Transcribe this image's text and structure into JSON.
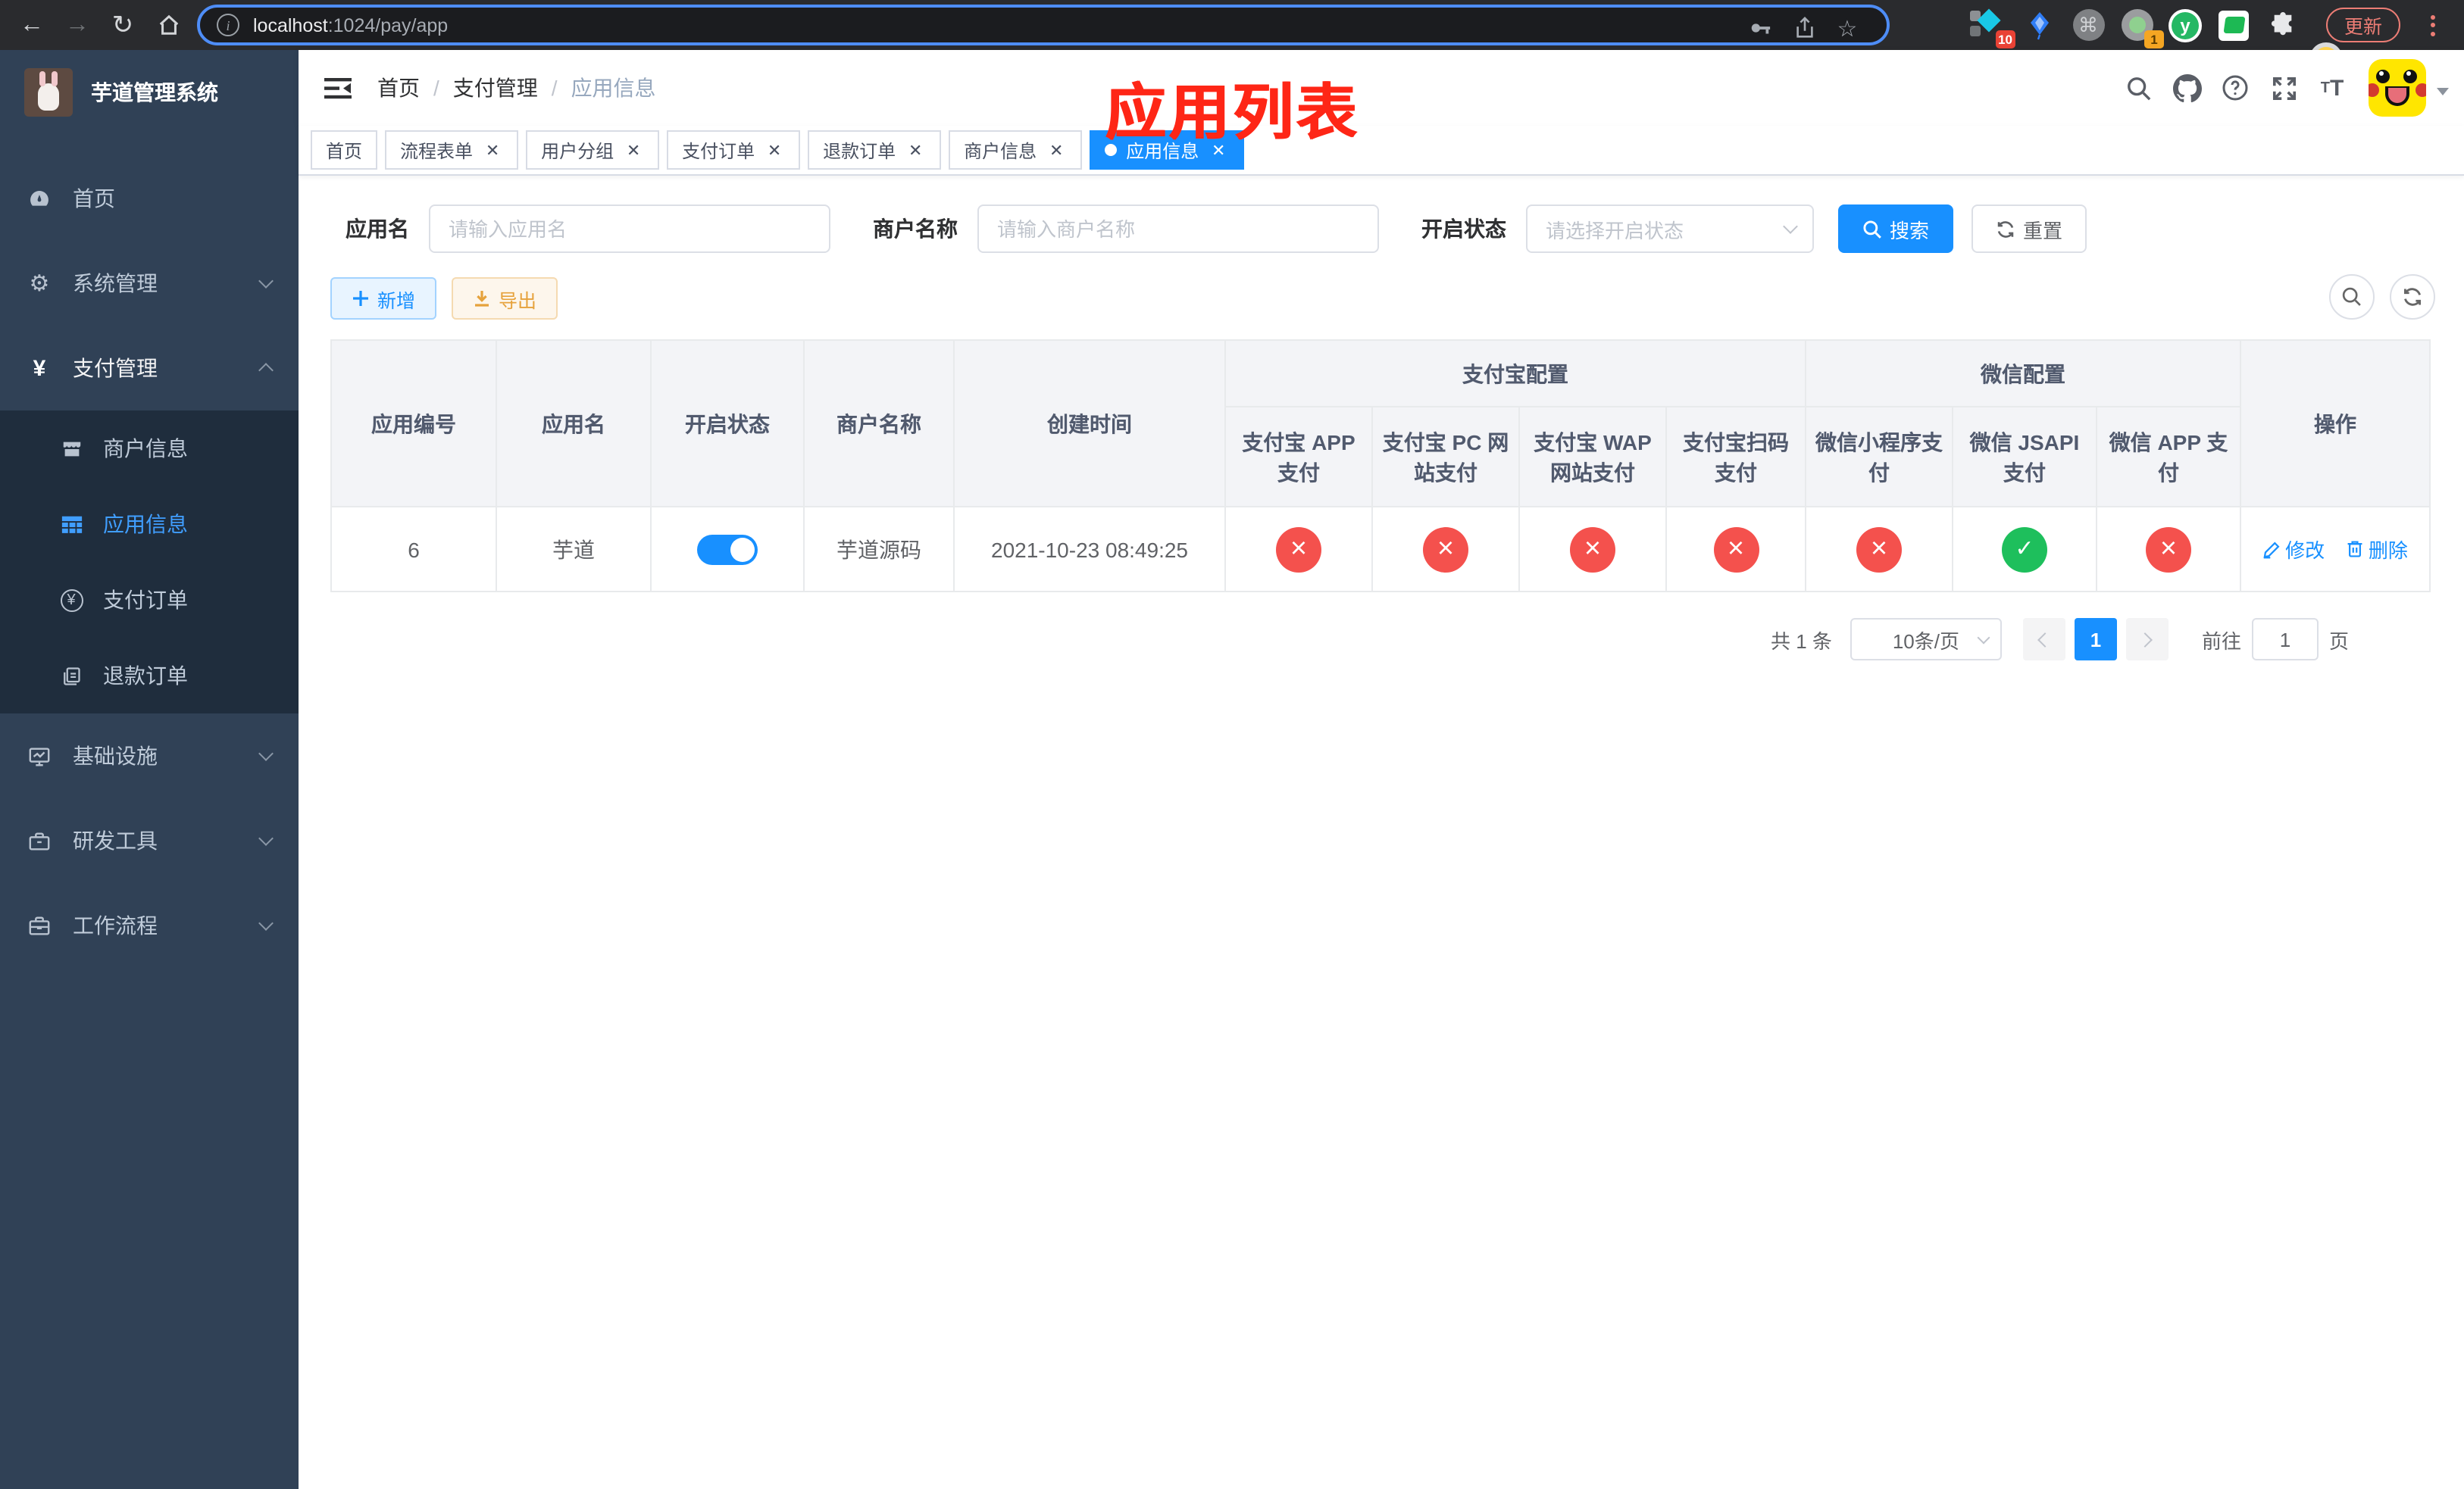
{
  "browser": {
    "url_host": "localhost",
    "url_path": ":1024/pay/app",
    "update_button": "更新",
    "ext_badge_1": "10",
    "ext_badge_2": "1",
    "ext_y_label": "y"
  },
  "sidebar": {
    "title": "芋道管理系统",
    "menu": [
      {
        "label": "首页"
      },
      {
        "label": "系统管理"
      },
      {
        "label": "支付管理"
      },
      {
        "label": "基础设施"
      },
      {
        "label": "研发工具"
      },
      {
        "label": "工作流程"
      }
    ],
    "submenu": [
      {
        "label": "商户信息"
      },
      {
        "label": "应用信息"
      },
      {
        "label": "支付订单"
      },
      {
        "label": "退款订单"
      }
    ]
  },
  "navbar": {
    "breadcrumb": [
      "首页",
      "支付管理",
      "应用信息"
    ]
  },
  "annotation": "应用列表",
  "tabs": [
    "首页",
    "流程表单",
    "用户分组",
    "支付订单",
    "退款订单",
    "商户信息",
    "应用信息"
  ],
  "filters": {
    "app_name_label": "应用名",
    "app_name_placeholder": "请输入应用名",
    "merchant_label": "商户名称",
    "merchant_placeholder": "请输入商户名称",
    "status_label": "开启状态",
    "status_placeholder": "请选择开启状态",
    "search_button": "搜索",
    "reset_button": "重置"
  },
  "toolbar": {
    "add_button": "新增",
    "export_button": "导出"
  },
  "table": {
    "columns": {
      "app_id": "应用编号",
      "app_name": "应用名",
      "status": "开启状态",
      "merchant": "商户名称",
      "create_time": "创建时间",
      "actions": "操作"
    },
    "groups": {
      "alipay": "支付宝配置",
      "wechat": "微信配置"
    },
    "pay_columns": [
      "支付宝 APP 支付",
      "支付宝 PC 网站支付",
      "支付宝 WAP 网站支付",
      "支付宝扫码支付",
      "微信小程序支付",
      "微信 JSAPI 支付",
      "微信 APP 支付"
    ],
    "row": {
      "app_id": "6",
      "app_name": "芋道",
      "status_on": true,
      "merchant": "芋道源码",
      "create_time": "2021-10-23 08:49:25",
      "pay_status": [
        "no",
        "no",
        "no",
        "no",
        "no",
        "yes",
        "no"
      ],
      "edit_link": "修改",
      "delete_link": "删除"
    }
  },
  "pagination": {
    "total": "共 1 条",
    "page_size": "10条/页",
    "current_page": "1",
    "goto_label": "前往",
    "goto_value": "1",
    "goto_suffix": "页"
  }
}
